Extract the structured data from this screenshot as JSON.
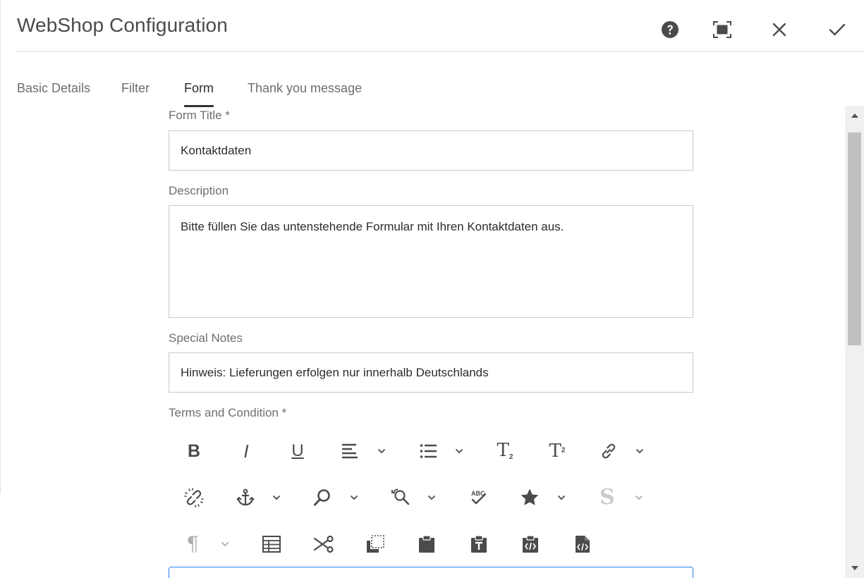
{
  "dialog": {
    "title": "WebShop Configuration",
    "icons": {
      "help": "help-circle-icon",
      "fullscreen": "fullscreen-icon",
      "close": "close-icon",
      "done": "checkmark-icon"
    }
  },
  "tabs": [
    {
      "label": "Basic Details",
      "active": false
    },
    {
      "label": "Filter",
      "active": false
    },
    {
      "label": "Form",
      "active": true
    },
    {
      "label": "Thank you message",
      "active": false
    }
  ],
  "form": {
    "form_title": {
      "label": "Form Title *",
      "value": "Kontaktdaten"
    },
    "description": {
      "label": "Description",
      "value": "Bitte füllen Sie das untenstehende Formular mit Ihren Kontaktdaten aus."
    },
    "special_notes": {
      "label": "Special Notes",
      "value": "Hinweis: Lieferungen erfolgen nur innerhalb Deutschlands"
    },
    "terms": {
      "label": "Terms and Condition *"
    }
  },
  "rte_toolbar": {
    "bold": "B",
    "italic": "I",
    "underline": "U",
    "strikethrough": "S",
    "subscript": "T",
    "subscript_mark": "2",
    "superscript": "T",
    "superscript_mark": "2",
    "paragraph": "¶",
    "icons": [
      "bold-icon",
      "italic-icon",
      "underline-icon",
      "align-icon",
      "list-icon",
      "subscript-icon",
      "superscript-icon",
      "link-icon",
      "unlink-icon",
      "anchor-icon",
      "find-icon",
      "replace-icon",
      "spellcheck-icon",
      "special-chars-icon",
      "styles-icon",
      "paragraph-format-icon",
      "table-icon",
      "cut-icon",
      "copy-icon",
      "paste-icon",
      "paste-text-icon",
      "paste-word-icon",
      "source-edit-icon"
    ]
  },
  "colors": {
    "text": "#4b4b4b",
    "label": "#6e6e6e",
    "border": "#cacaca",
    "focus": "#2680eb",
    "tab_indicator": "#323232"
  }
}
